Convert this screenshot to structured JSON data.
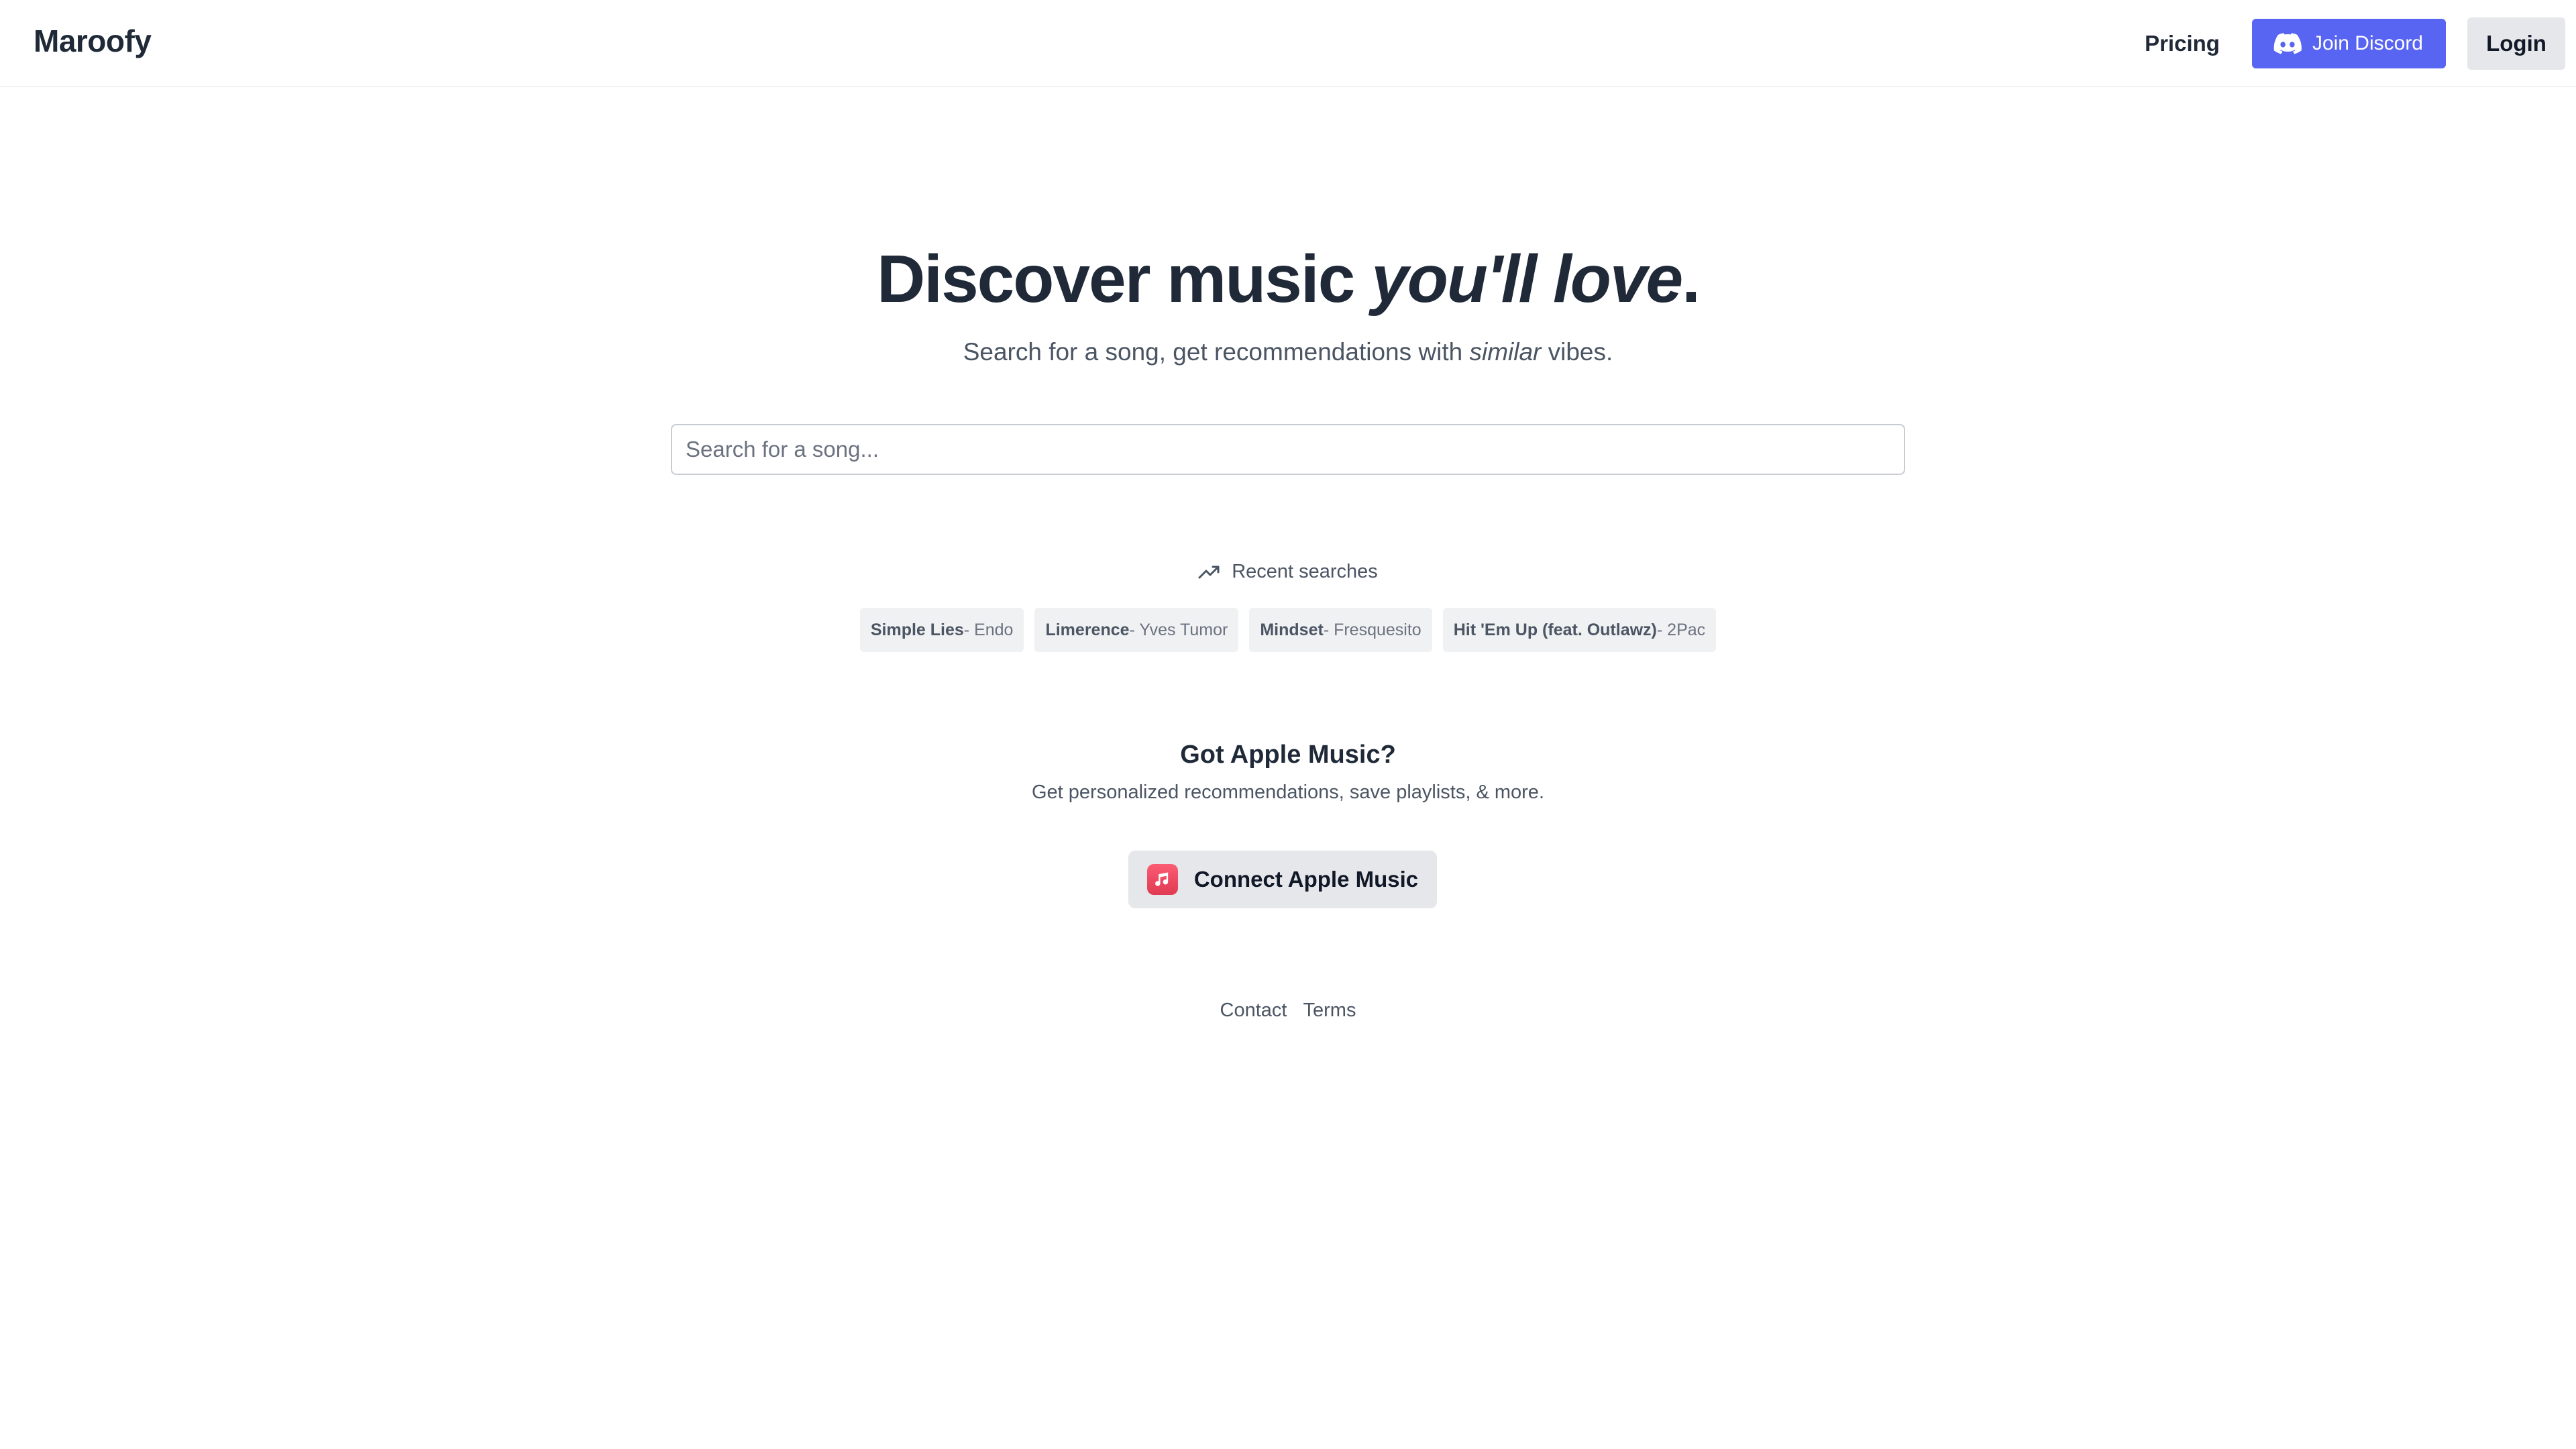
{
  "header": {
    "logo": "Maroofy",
    "nav": {
      "pricing": "Pricing",
      "discord": "Join Discord",
      "login": "Login"
    }
  },
  "hero": {
    "title_part1": "Discover music ",
    "title_emphasis": "you'll love",
    "title_end": ".",
    "subtitle_part1": "Search for a song, get recommendations with ",
    "subtitle_emphasis": "similar",
    "subtitle_part2": " vibes."
  },
  "search": {
    "placeholder": "Search for a song...",
    "value": ""
  },
  "recent": {
    "label": "Recent searches",
    "icon": "trending-up-icon",
    "items": [
      {
        "song": "Simple Lies",
        "artist": " - Endo"
      },
      {
        "song": "Limerence",
        "artist": " - Yves Tumor"
      },
      {
        "song": "Mindset",
        "artist": " - Fresquesito"
      },
      {
        "song": "Hit 'Em Up (feat. Outlawz)",
        "artist": " - 2Pac"
      }
    ]
  },
  "apple_music": {
    "title": "Got Apple Music?",
    "subtitle": "Get personalized recommendations, save playlists, & more.",
    "button": "Connect Apple Music",
    "icon": "apple-music-icon"
  },
  "footer": {
    "links": [
      "Contact",
      "Terms"
    ]
  },
  "colors": {
    "discord": "#5865f2",
    "button_gray": "#e6e7ea",
    "chip_bg": "#f0f1f3",
    "apple_red": "#fa4659",
    "text_dark": "#1f2937",
    "text_muted": "#4b5563"
  }
}
